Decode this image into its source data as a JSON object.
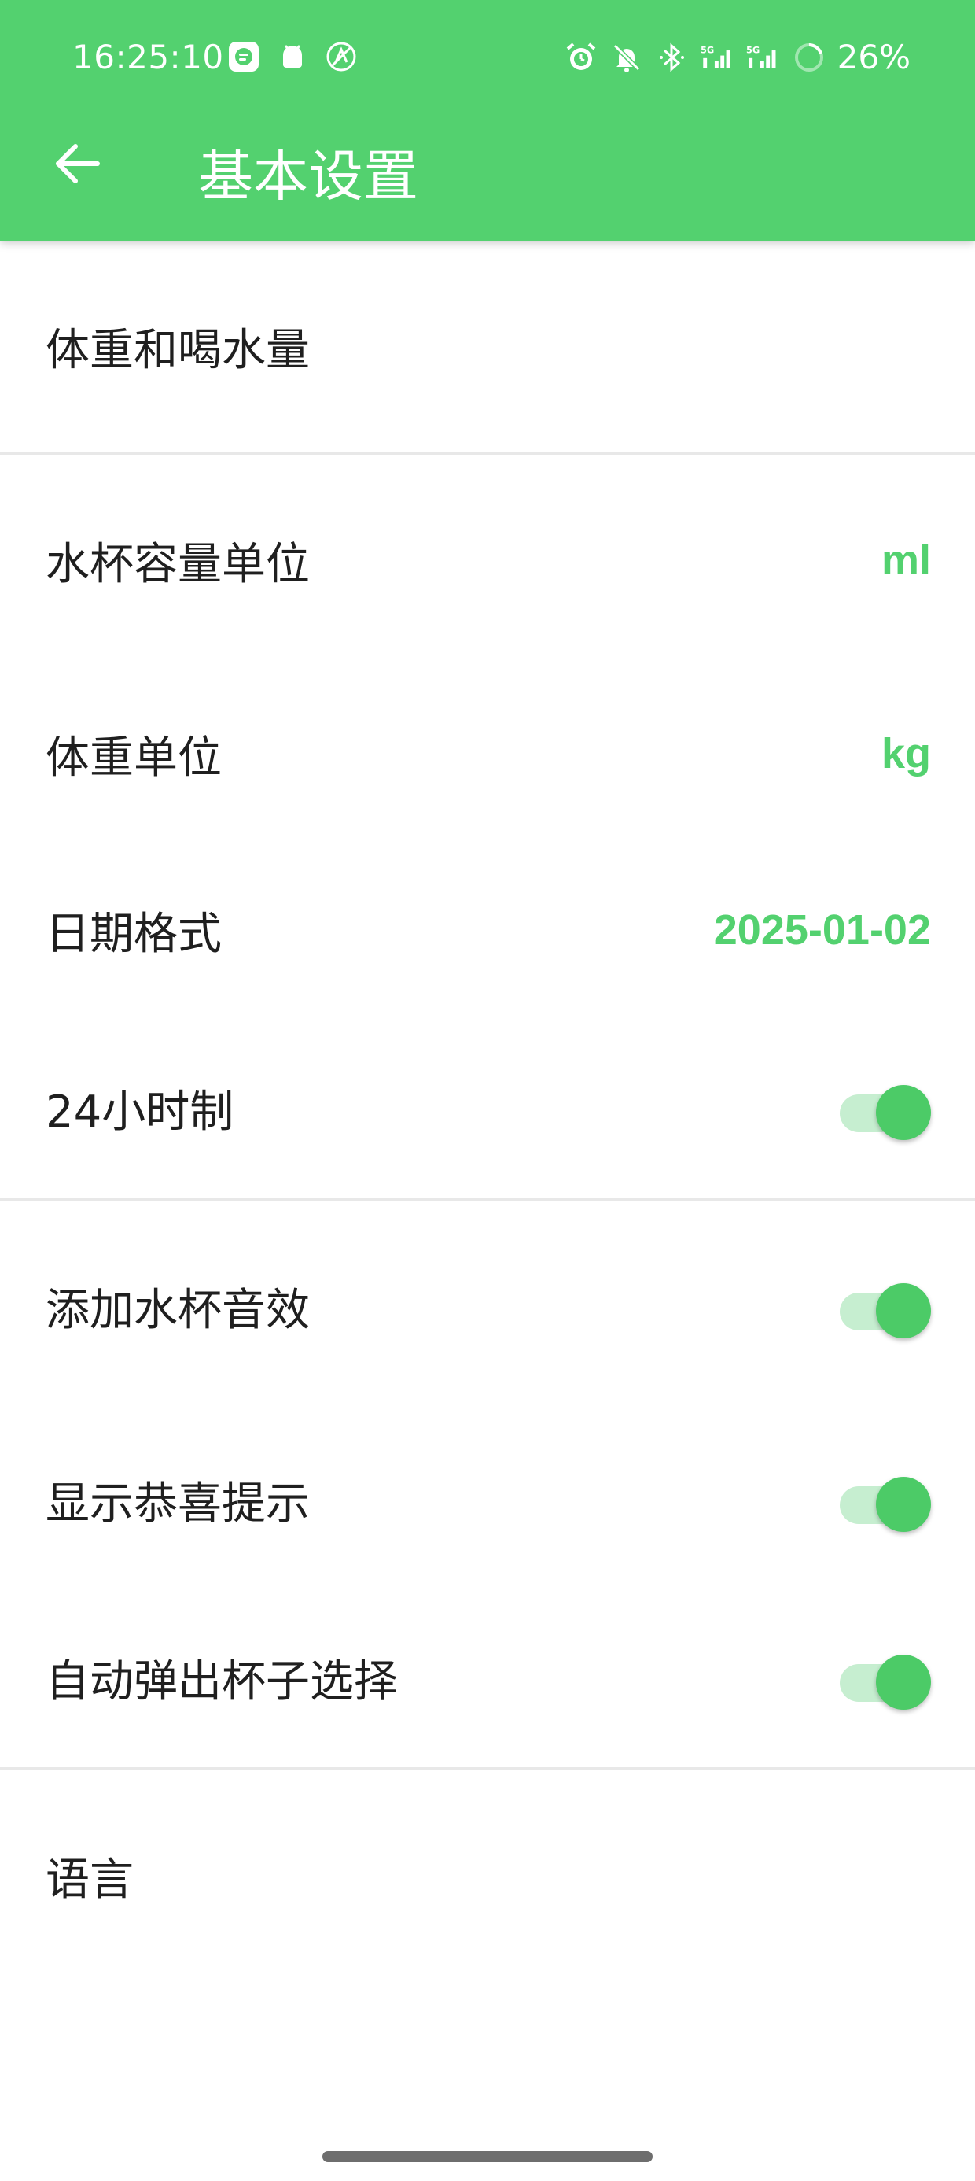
{
  "status_bar": {
    "time": "16:25:10",
    "battery": "26%",
    "left_icons": [
      "chat-app-icon",
      "android-debug-icon",
      "no-location-icon"
    ],
    "right_icons": [
      "alarm-icon",
      "mute-bell-icon",
      "bluetooth-icon",
      "signal-5g-icon",
      "signal-5g-icon",
      "battery-ring-icon"
    ]
  },
  "app_bar": {
    "title": "基本设置",
    "back_icon": "arrow-left-icon",
    "color": "#53d16f"
  },
  "sections": [
    {
      "rows": [
        {
          "label": "体重和喝水量"
        }
      ]
    },
    {
      "rows": [
        {
          "label": "水杯容量单位",
          "value": "ml"
        },
        {
          "label": "体重单位",
          "value": "kg"
        },
        {
          "label": "日期格式",
          "value": "2025-01-02"
        },
        {
          "label": "24小时制",
          "toggle": true
        }
      ]
    },
    {
      "rows": [
        {
          "label": "添加水杯音效",
          "toggle": true
        },
        {
          "label": "显示恭喜提示",
          "toggle": true
        },
        {
          "label": "自动弹出杯子选择",
          "toggle": true
        }
      ]
    },
    {
      "rows": [
        {
          "label": "语言"
        }
      ]
    }
  ],
  "colors": {
    "accent": "#53d16f",
    "toggle_track": "#c6eed0",
    "divider": "#e8e8e8"
  }
}
